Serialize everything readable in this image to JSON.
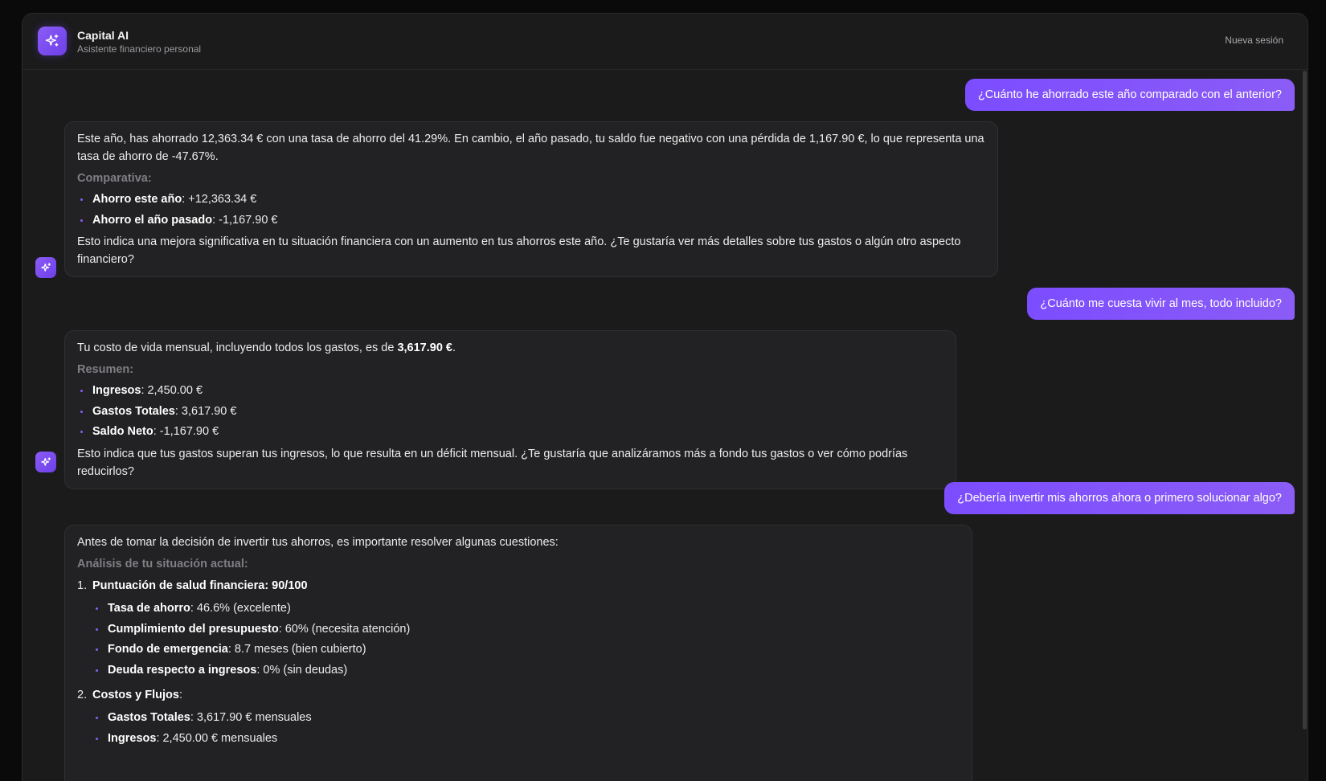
{
  "header": {
    "title": "Capital AI",
    "subtitle": "Asistente financiero personal",
    "new_session": "Nueva sesión"
  },
  "messages": {
    "user1": "¿Cuánto he ahorrado este año comparado con el anterior?",
    "bot1": {
      "intro": "Este año, has ahorrado 12,363.34 € con una tasa de ahorro del 41.29%. En cambio, el año pasado, tu saldo fue negativo con una pérdida de 1,167.90 €, lo que representa una tasa de ahorro de -47.67%.",
      "label": "Comparativa:",
      "items": [
        {
          "key": "Ahorro este año",
          "value": ": +12,363.34 €"
        },
        {
          "key": "Ahorro el año pasado",
          "value": ": -1,167.90 €"
        }
      ],
      "outro": "Esto indica una mejora significativa en tu situación financiera con un aumento en tus ahorros este año. ¿Te gustaría ver más detalles sobre tus gastos o algún otro aspecto financiero?"
    },
    "user2": "¿Cuánto me cuesta vivir al mes, todo incluido?",
    "bot2": {
      "intro_pre": "Tu costo de vida mensual, incluyendo todos los gastos, es de ",
      "intro_bold": "3,617.90 €",
      "intro_post": ".",
      "label": "Resumen:",
      "items": [
        {
          "key": "Ingresos",
          "value": ": 2,450.00 €"
        },
        {
          "key": "Gastos Totales",
          "value": ": 3,617.90 €"
        },
        {
          "key": "Saldo Neto",
          "value": ": -1,167.90 €"
        }
      ],
      "outro": "Esto indica que tus gastos superan tus ingresos, lo que resulta en un déficit mensual. ¿Te gustaría que analizáramos más a fondo tus gastos o ver cómo podrías reducirlos?"
    },
    "user3": "¿Debería invertir mis ahorros ahora o primero solucionar algo?",
    "bot3": {
      "intro": "Antes de tomar la decisión de invertir tus ahorros, es importante resolver algunas cuestiones:",
      "label": "Análisis de tu situación actual:",
      "sections": [
        {
          "num": "1.",
          "title": "Puntuación de salud financiera: 90/100",
          "items": [
            {
              "key": "Tasa de ahorro",
              "value": ": 46.6% (excelente)"
            },
            {
              "key": "Cumplimiento del presupuesto",
              "value": ": 60% (necesita atención)"
            },
            {
              "key": "Fondo de emergencia",
              "value": ": 8.7 meses (bien cubierto)"
            },
            {
              "key": "Deuda respecto a ingresos",
              "value": ": 0% (sin deudas)"
            }
          ]
        },
        {
          "num": "2.",
          "title": "Costos y Flujos",
          "title_suffix": ":",
          "items": [
            {
              "key": "Gastos Totales",
              "value": ": 3,617.90 € mensuales"
            },
            {
              "key": "Ingresos",
              "value": ": 2,450.00 € mensuales"
            }
          ]
        }
      ]
    }
  }
}
